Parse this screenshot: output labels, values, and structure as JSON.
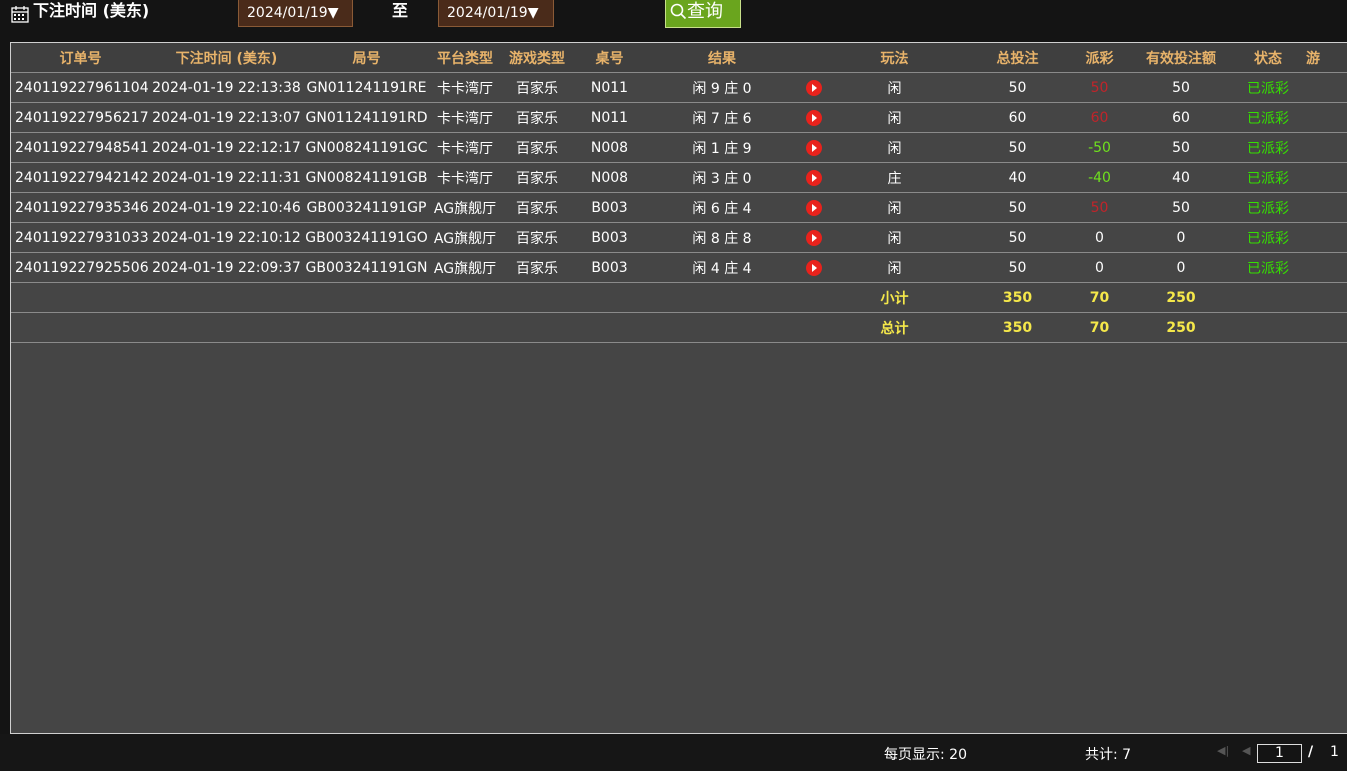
{
  "filter": {
    "label": "下注时间 (美东)",
    "date_from": "2024/01/19▼",
    "to_label": "至",
    "date_to": "2024/01/19▼",
    "search_label": "查询"
  },
  "table": {
    "headers": [
      "订单号",
      "下注时间 (美东)",
      "局号",
      "平台类型",
      "游戏类型",
      "桌号",
      "结果",
      "",
      "玩法",
      "总投注",
      "派彩",
      "有效投注额",
      "状态",
      "游"
    ],
    "rows": [
      {
        "order": "240119227961104",
        "time": "2024-01-19 22:13:38",
        "round": "GN011241191RE",
        "platform": "卡卡湾厅",
        "game": "百家乐",
        "table": "N011",
        "result": "闲 9 庄 0",
        "bet_type": "闲",
        "total": "50",
        "payout": "50",
        "valid": "50",
        "status": "已派彩"
      },
      {
        "order": "240119227956217",
        "time": "2024-01-19 22:13:07",
        "round": "GN011241191RD",
        "platform": "卡卡湾厅",
        "game": "百家乐",
        "table": "N011",
        "result": "闲 7 庄 6",
        "bet_type": "闲",
        "total": "60",
        "payout": "60",
        "valid": "60",
        "status": "已派彩"
      },
      {
        "order": "240119227948541",
        "time": "2024-01-19 22:12:17",
        "round": "GN008241191GC",
        "platform": "卡卡湾厅",
        "game": "百家乐",
        "table": "N008",
        "result": "闲 1 庄 9",
        "bet_type": "闲",
        "total": "50",
        "payout": "-50",
        "valid": "50",
        "status": "已派彩"
      },
      {
        "order": "240119227942142",
        "time": "2024-01-19 22:11:31",
        "round": "GN008241191GB",
        "platform": "卡卡湾厅",
        "game": "百家乐",
        "table": "N008",
        "result": "闲 3 庄 0",
        "bet_type": "庄",
        "total": "40",
        "payout": "-40",
        "valid": "40",
        "status": "已派彩"
      },
      {
        "order": "240119227935346",
        "time": "2024-01-19 22:10:46",
        "round": "GB003241191GP",
        "platform": "AG旗舰厅",
        "game": "百家乐",
        "table": "B003",
        "result": "闲 6 庄 4",
        "bet_type": "闲",
        "total": "50",
        "payout": "50",
        "valid": "50",
        "status": "已派彩"
      },
      {
        "order": "240119227931033",
        "time": "2024-01-19 22:10:12",
        "round": "GB003241191GO",
        "platform": "AG旗舰厅",
        "game": "百家乐",
        "table": "B003",
        "result": "闲 8 庄 8",
        "bet_type": "闲",
        "total": "50",
        "payout": "0",
        "valid": "0",
        "status": "已派彩"
      },
      {
        "order": "240119227925506",
        "time": "2024-01-19 22:09:37",
        "round": "GB003241191GN",
        "platform": "AG旗舰厅",
        "game": "百家乐",
        "table": "B003",
        "result": "闲 4 庄 4",
        "bet_type": "闲",
        "total": "50",
        "payout": "0",
        "valid": "0",
        "status": "已派彩"
      }
    ],
    "subtotal": {
      "label": "小计",
      "total": "350",
      "payout": "70",
      "valid": "250"
    },
    "grand_total": {
      "label": "总计",
      "total": "350",
      "payout": "70",
      "valid": "250"
    }
  },
  "footer": {
    "per_page": "每页显示: 20",
    "total_count": "共计: 7",
    "first_icon": "first-page-icon",
    "prev_icon": "prev-page-icon",
    "page_current": "1",
    "page_sep": "/",
    "page_total": "1"
  },
  "colors": {
    "header_text": "#e8b36a",
    "positive_payout": "#c0242a",
    "negative_payout": "#6fe01e",
    "status": "#35e000",
    "totals": "#f5e84a",
    "search_button": "#6aa51e"
  }
}
